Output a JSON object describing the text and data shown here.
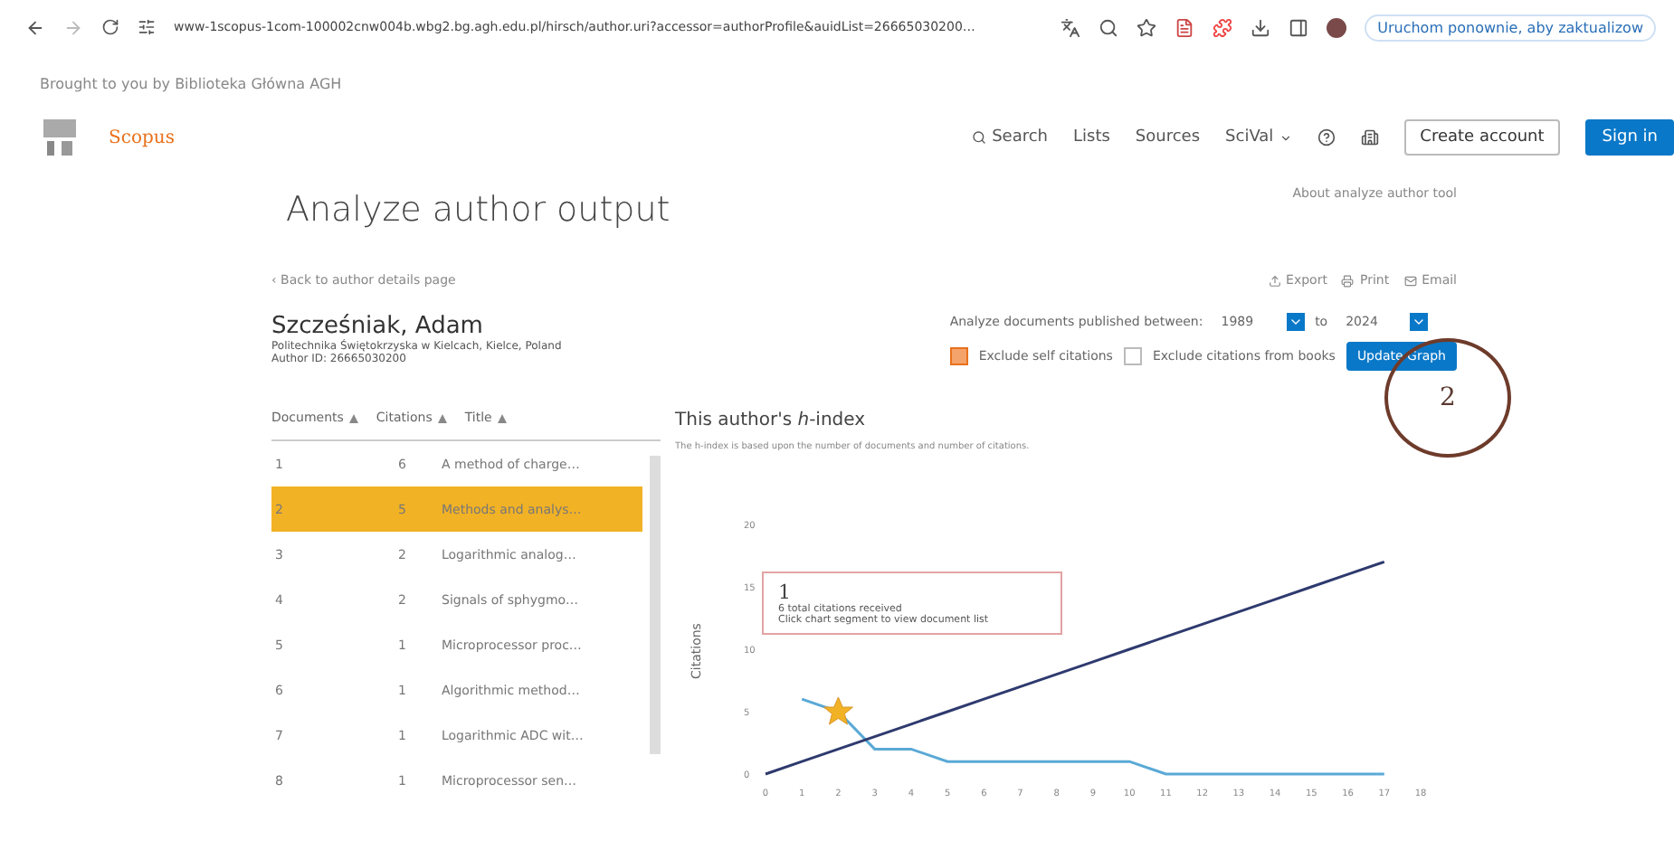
{
  "browser": {
    "url": "www-1scopus-1com-100002cnw004b.wbg2.bg.agh.edu.pl/hirsch/author.uri?accessor=authorProfile&auidList=26665030200…",
    "update_notice": "Uruchom ponownie, aby zaktualizow"
  },
  "banner": "Brought to you by Biblioteka Główna AGH",
  "header": {
    "logo": "Scopus",
    "nav": [
      "Search",
      "Lists",
      "Sources",
      "SciVal"
    ],
    "buttons": [
      {
        "label": "Create account",
        "kind": "outline"
      },
      {
        "label": "Sign in",
        "kind": "primary"
      }
    ]
  },
  "page_title": "Analyze author output",
  "about_link": "About analyze author tool",
  "back_link": "‹ Back to author details page",
  "actions": [
    "Export",
    "Print",
    "Email"
  ],
  "author": {
    "name": "Szcześniak, Adam",
    "affiliation": "Politechnika Świętokrzyska w Kielcach, Kielce, Poland",
    "author_id": "Author ID: 26665030200"
  },
  "filters": {
    "label": "Analyze documents published between:",
    "from": "1989",
    "to_label": "to",
    "to": "2024",
    "exclude_self": {
      "label": "Exclude self citations",
      "checked": true
    },
    "exclude_books": {
      "label": "Exclude citations from books",
      "checked": false
    },
    "button": "Update Graph"
  },
  "table": {
    "columns": [
      "Documents",
      "Citations",
      "Title"
    ],
    "rows": [
      {
        "doc": "1",
        "citations": "6",
        "title": "A method of charge…",
        "selected": false
      },
      {
        "doc": "2",
        "citations": "5",
        "title": "Methods and analys…",
        "selected": true
      },
      {
        "doc": "3",
        "citations": "2",
        "title": "Logarithmic analog…",
        "selected": false
      },
      {
        "doc": "4",
        "citations": "2",
        "title": "Signals of sphygmo…",
        "selected": false
      },
      {
        "doc": "5",
        "citations": "1",
        "title": "Microprocessor proc…",
        "selected": false
      },
      {
        "doc": "6",
        "citations": "1",
        "title": "Algorithmic method…",
        "selected": false
      },
      {
        "doc": "7",
        "citations": "1",
        "title": "Logarithmic ADC wit…",
        "selected": false
      },
      {
        "doc": "8",
        "citations": "1",
        "title": "Microprocessor sen…",
        "selected": false
      }
    ]
  },
  "hindex": {
    "title": "This author's *h*-index",
    "description": "The h-index is based upon the number of documents and number of citations.",
    "chart_data": {
      "type": "line",
      "ylabel": "Citations",
      "x": [
        0,
        1,
        2,
        3,
        4,
        5,
        6,
        7,
        8,
        9,
        10,
        11,
        12,
        13,
        14,
        15,
        16,
        17
      ],
      "series": [
        {
          "color": "#5aa9d6",
          "values": [
            null,
            6,
            5,
            2,
            2,
            1,
            1,
            1,
            1,
            1,
            1,
            0,
            0,
            0,
            0,
            0,
            0,
            0
          ]
        },
        {
          "color": "#2e3a6e",
          "values": [
            0,
            1,
            2,
            3,
            4,
            5,
            6,
            7,
            8,
            9,
            10,
            11,
            12,
            13,
            14,
            15,
            16,
            17
          ]
        }
      ],
      "xlim": [
        0,
        18
      ],
      "ylim": [
        0,
        20
      ],
      "xticks": [
        0,
        1,
        2,
        3,
        4,
        5,
        6,
        7,
        8,
        9,
        10,
        11,
        12,
        13,
        14,
        15,
        16,
        17,
        18
      ],
      "yticks": [
        0,
        5,
        10,
        15,
        20
      ]
    },
    "tooltip": {
      "title": "1",
      "lines": [
        "6 total citations received",
        "Click chart segment to view document list"
      ]
    },
    "annotation": "2"
  }
}
